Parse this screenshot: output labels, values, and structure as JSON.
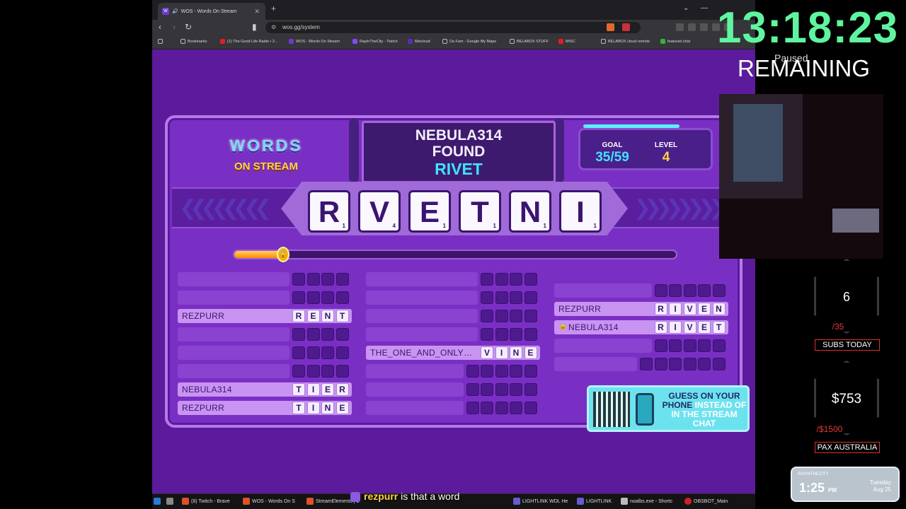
{
  "browser": {
    "tab_title": "WOS - Words On Stream",
    "url": "wos.gg/system",
    "bookmarks": [
      "Bookmarks",
      "(1) The Good Life Radio • 2...",
      "WOS - Words On Stream",
      "RayInTheCity - Twitch",
      "Mixcloud",
      "Da Fam - Google My Maps",
      "BELABOX STUFF",
      "MISC",
      "BELABOX cloud remote",
      "featured.chat"
    ]
  },
  "game": {
    "logo_top": "WORDS",
    "logo_bottom": "ON STREAM",
    "found_name": "NEBULA314",
    "found_label": "FOUND",
    "found_word": "RIVET",
    "goal_label": "GOAL",
    "goal_value": "35/59",
    "level_label": "LEVEL",
    "level_value": "4",
    "letters": [
      {
        "ch": "R",
        "pts": "1"
      },
      {
        "ch": "V",
        "pts": "4"
      },
      {
        "ch": "E",
        "pts": "1"
      },
      {
        "ch": "T",
        "pts": "1"
      },
      {
        "ch": "N",
        "pts": "1"
      },
      {
        "ch": "I",
        "pts": "1"
      }
    ],
    "progress_fraction": 0.12,
    "columns": [
      [
        {
          "name": "",
          "letters": [
            "",
            "",
            "",
            ""
          ]
        },
        {
          "name": "",
          "letters": [
            "",
            "",
            "",
            ""
          ]
        },
        {
          "name": "REZPURR",
          "letters": [
            "R",
            "E",
            "N",
            "T"
          ]
        },
        {
          "name": "",
          "letters": [
            "",
            "",
            "",
            ""
          ]
        },
        {
          "name": "",
          "letters": [
            "",
            "",
            "",
            ""
          ]
        },
        {
          "name": "",
          "letters": [
            "",
            "",
            "",
            ""
          ]
        },
        {
          "name": "NEBULA314",
          "letters": [
            "T",
            "I",
            "E",
            "R"
          ]
        },
        {
          "name": "REZPURR",
          "letters": [
            "T",
            "I",
            "N",
            "E"
          ]
        }
      ],
      [
        {
          "name": "",
          "letters": [
            "",
            "",
            "",
            ""
          ]
        },
        {
          "name": "",
          "letters": [
            "",
            "",
            "",
            ""
          ]
        },
        {
          "name": "",
          "letters": [
            "",
            "",
            "",
            ""
          ]
        },
        {
          "name": "",
          "letters": [
            "",
            "",
            "",
            ""
          ]
        },
        {
          "name": "THE_ONE_AND_ONLY…",
          "letters": [
            "V",
            "I",
            "N",
            "E"
          ]
        },
        {
          "name": "",
          "letters": [
            "",
            "",
            "",
            "",
            ""
          ]
        },
        {
          "name": "",
          "letters": [
            "",
            "",
            "",
            "",
            ""
          ]
        },
        {
          "name": "",
          "letters": [
            "",
            "",
            "",
            "",
            ""
          ]
        }
      ],
      [
        {
          "name": "",
          "letters": [
            "",
            "",
            "",
            "",
            ""
          ]
        },
        {
          "name": "REZPURR",
          "letters": [
            "R",
            "I",
            "V",
            "E",
            "N"
          ]
        },
        {
          "name": "NEBULA314",
          "letters": [
            "R",
            "I",
            "V",
            "E",
            "T"
          ],
          "locked": true
        },
        {
          "name": "",
          "letters": [
            "",
            "",
            "",
            "",
            ""
          ]
        },
        {
          "name": "",
          "letters": [
            "",
            "",
            "",
            "",
            "",
            ""
          ]
        }
      ]
    ],
    "qr_text_a": "GUESS ON YOUR PHONE",
    "qr_text_b": "INSTEAD OF IN THE STREAM CHAT"
  },
  "overlay": {
    "timer": "13:18:23",
    "paused": "Paused",
    "remaining": "REMAINING",
    "subs_count": "6",
    "subs_goal": "/35",
    "subs_label": "SUBS TODAY",
    "money_count": "$753",
    "money_goal": "/$1500",
    "money_label": "PAX AUSTRALIA",
    "clock_header": "RAYINTHECITY",
    "clock_time": "1:25",
    "clock_ampm": "PM",
    "clock_day": "Tuesday",
    "clock_date": "Aug 25"
  },
  "chat": {
    "user": "rezpurr",
    "message": " is that a word"
  },
  "taskbar": [
    "(8) Twitch - Brave",
    "WOS - Words On S",
    "StreamElements | 1",
    "",
    "LIGHTLINK WDL He",
    "LIGHTLINK",
    "noalbs.exe - Shortc",
    "OBSBOT_Main"
  ]
}
